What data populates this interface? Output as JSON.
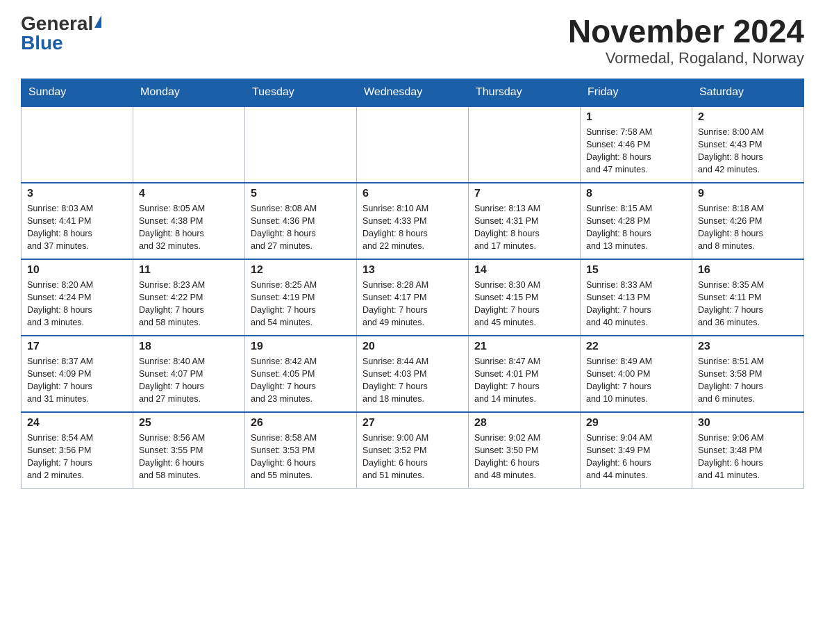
{
  "logo": {
    "general": "General",
    "blue": "Blue"
  },
  "title": "November 2024",
  "subtitle": "Vormedal, Rogaland, Norway",
  "days_of_week": [
    "Sunday",
    "Monday",
    "Tuesday",
    "Wednesday",
    "Thursday",
    "Friday",
    "Saturday"
  ],
  "weeks": [
    [
      {
        "day": "",
        "info": ""
      },
      {
        "day": "",
        "info": ""
      },
      {
        "day": "",
        "info": ""
      },
      {
        "day": "",
        "info": ""
      },
      {
        "day": "",
        "info": ""
      },
      {
        "day": "1",
        "info": "Sunrise: 7:58 AM\nSunset: 4:46 PM\nDaylight: 8 hours\nand 47 minutes."
      },
      {
        "day": "2",
        "info": "Sunrise: 8:00 AM\nSunset: 4:43 PM\nDaylight: 8 hours\nand 42 minutes."
      }
    ],
    [
      {
        "day": "3",
        "info": "Sunrise: 8:03 AM\nSunset: 4:41 PM\nDaylight: 8 hours\nand 37 minutes."
      },
      {
        "day": "4",
        "info": "Sunrise: 8:05 AM\nSunset: 4:38 PM\nDaylight: 8 hours\nand 32 minutes."
      },
      {
        "day": "5",
        "info": "Sunrise: 8:08 AM\nSunset: 4:36 PM\nDaylight: 8 hours\nand 27 minutes."
      },
      {
        "day": "6",
        "info": "Sunrise: 8:10 AM\nSunset: 4:33 PM\nDaylight: 8 hours\nand 22 minutes."
      },
      {
        "day": "7",
        "info": "Sunrise: 8:13 AM\nSunset: 4:31 PM\nDaylight: 8 hours\nand 17 minutes."
      },
      {
        "day": "8",
        "info": "Sunrise: 8:15 AM\nSunset: 4:28 PM\nDaylight: 8 hours\nand 13 minutes."
      },
      {
        "day": "9",
        "info": "Sunrise: 8:18 AM\nSunset: 4:26 PM\nDaylight: 8 hours\nand 8 minutes."
      }
    ],
    [
      {
        "day": "10",
        "info": "Sunrise: 8:20 AM\nSunset: 4:24 PM\nDaylight: 8 hours\nand 3 minutes."
      },
      {
        "day": "11",
        "info": "Sunrise: 8:23 AM\nSunset: 4:22 PM\nDaylight: 7 hours\nand 58 minutes."
      },
      {
        "day": "12",
        "info": "Sunrise: 8:25 AM\nSunset: 4:19 PM\nDaylight: 7 hours\nand 54 minutes."
      },
      {
        "day": "13",
        "info": "Sunrise: 8:28 AM\nSunset: 4:17 PM\nDaylight: 7 hours\nand 49 minutes."
      },
      {
        "day": "14",
        "info": "Sunrise: 8:30 AM\nSunset: 4:15 PM\nDaylight: 7 hours\nand 45 minutes."
      },
      {
        "day": "15",
        "info": "Sunrise: 8:33 AM\nSunset: 4:13 PM\nDaylight: 7 hours\nand 40 minutes."
      },
      {
        "day": "16",
        "info": "Sunrise: 8:35 AM\nSunset: 4:11 PM\nDaylight: 7 hours\nand 36 minutes."
      }
    ],
    [
      {
        "day": "17",
        "info": "Sunrise: 8:37 AM\nSunset: 4:09 PM\nDaylight: 7 hours\nand 31 minutes."
      },
      {
        "day": "18",
        "info": "Sunrise: 8:40 AM\nSunset: 4:07 PM\nDaylight: 7 hours\nand 27 minutes."
      },
      {
        "day": "19",
        "info": "Sunrise: 8:42 AM\nSunset: 4:05 PM\nDaylight: 7 hours\nand 23 minutes."
      },
      {
        "day": "20",
        "info": "Sunrise: 8:44 AM\nSunset: 4:03 PM\nDaylight: 7 hours\nand 18 minutes."
      },
      {
        "day": "21",
        "info": "Sunrise: 8:47 AM\nSunset: 4:01 PM\nDaylight: 7 hours\nand 14 minutes."
      },
      {
        "day": "22",
        "info": "Sunrise: 8:49 AM\nSunset: 4:00 PM\nDaylight: 7 hours\nand 10 minutes."
      },
      {
        "day": "23",
        "info": "Sunrise: 8:51 AM\nSunset: 3:58 PM\nDaylight: 7 hours\nand 6 minutes."
      }
    ],
    [
      {
        "day": "24",
        "info": "Sunrise: 8:54 AM\nSunset: 3:56 PM\nDaylight: 7 hours\nand 2 minutes."
      },
      {
        "day": "25",
        "info": "Sunrise: 8:56 AM\nSunset: 3:55 PM\nDaylight: 6 hours\nand 58 minutes."
      },
      {
        "day": "26",
        "info": "Sunrise: 8:58 AM\nSunset: 3:53 PM\nDaylight: 6 hours\nand 55 minutes."
      },
      {
        "day": "27",
        "info": "Sunrise: 9:00 AM\nSunset: 3:52 PM\nDaylight: 6 hours\nand 51 minutes."
      },
      {
        "day": "28",
        "info": "Sunrise: 9:02 AM\nSunset: 3:50 PM\nDaylight: 6 hours\nand 48 minutes."
      },
      {
        "day": "29",
        "info": "Sunrise: 9:04 AM\nSunset: 3:49 PM\nDaylight: 6 hours\nand 44 minutes."
      },
      {
        "day": "30",
        "info": "Sunrise: 9:06 AM\nSunset: 3:48 PM\nDaylight: 6 hours\nand 41 minutes."
      }
    ]
  ]
}
